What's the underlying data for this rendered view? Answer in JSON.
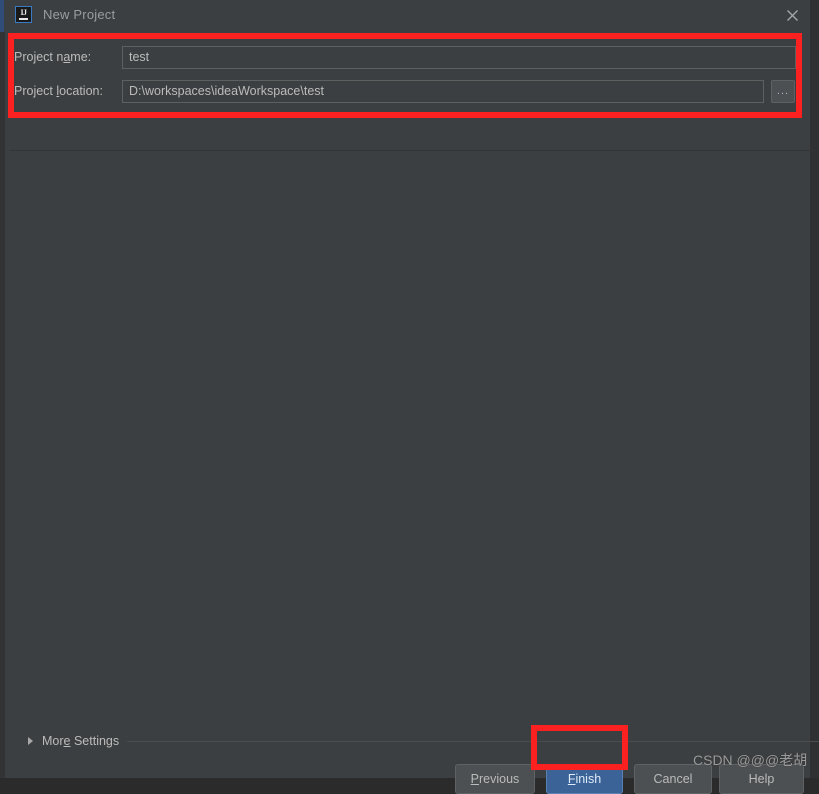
{
  "window": {
    "title": "New Project",
    "app_icon": "intellij-idea-icon",
    "icon_letters": "IJ",
    "close_icon": "close-icon"
  },
  "form": {
    "rows": [
      {
        "label_before": "Project n",
        "label_mnemonic": "a",
        "label_after": "me:",
        "value": "test",
        "placeholder": ""
      },
      {
        "label_before": "Project ",
        "label_mnemonic": "l",
        "label_after": "ocation:",
        "value": "D:\\workspaces\\ideaWorkspace\\test",
        "placeholder": ""
      }
    ],
    "browse_button_label": "..."
  },
  "more_settings": {
    "label_before": "Mor",
    "label_mnemonic": "e",
    "label_after": " Settings",
    "expanded": false,
    "arrow_icon": "chevron-right-icon"
  },
  "buttons": {
    "previous": {
      "before": "",
      "mnemonic": "P",
      "after": "revious"
    },
    "finish": {
      "before": "",
      "mnemonic": "F",
      "after": "inish"
    },
    "cancel": {
      "before": "Cancel",
      "mnemonic": "",
      "after": ""
    },
    "help": {
      "before": "Help",
      "mnemonic": "",
      "after": ""
    }
  },
  "watermark": {
    "text": "CSDN @@@老胡"
  },
  "annotations": {
    "color": "#fb2121",
    "boxes": [
      "form-fields-highlight",
      "finish-button-highlight"
    ]
  },
  "colors": {
    "dialog_background": "#3c3f41",
    "titlebar_background": "#3c3f41",
    "field_border": "#5e6060",
    "text_primary": "#bbbbbb",
    "text_title": "#9a9c9e",
    "primary_button": "#3c6398",
    "annotation_red": "#fb2121"
  }
}
